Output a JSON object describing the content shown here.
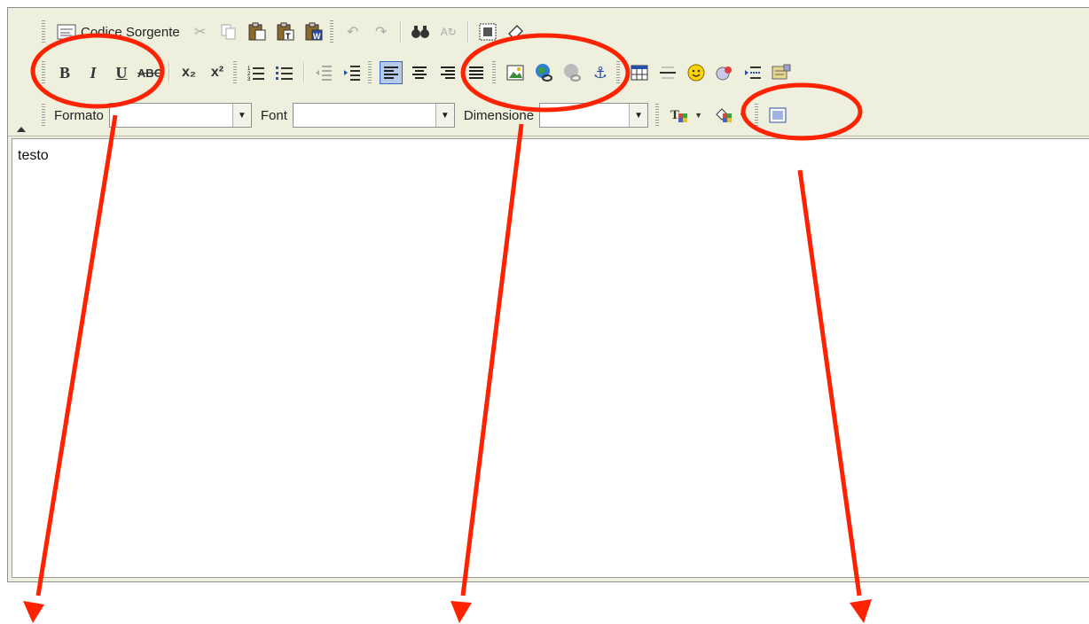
{
  "toolbar": {
    "row1": {
      "source_label": "Codice Sorgente"
    },
    "row3": {
      "format_label": "Formato",
      "font_label": "Font",
      "size_label": "Dimensione",
      "format_value": "",
      "font_value": "",
      "size_value": ""
    }
  },
  "content": {
    "text": "testo"
  },
  "annotation": {
    "color": "#ff2200"
  }
}
